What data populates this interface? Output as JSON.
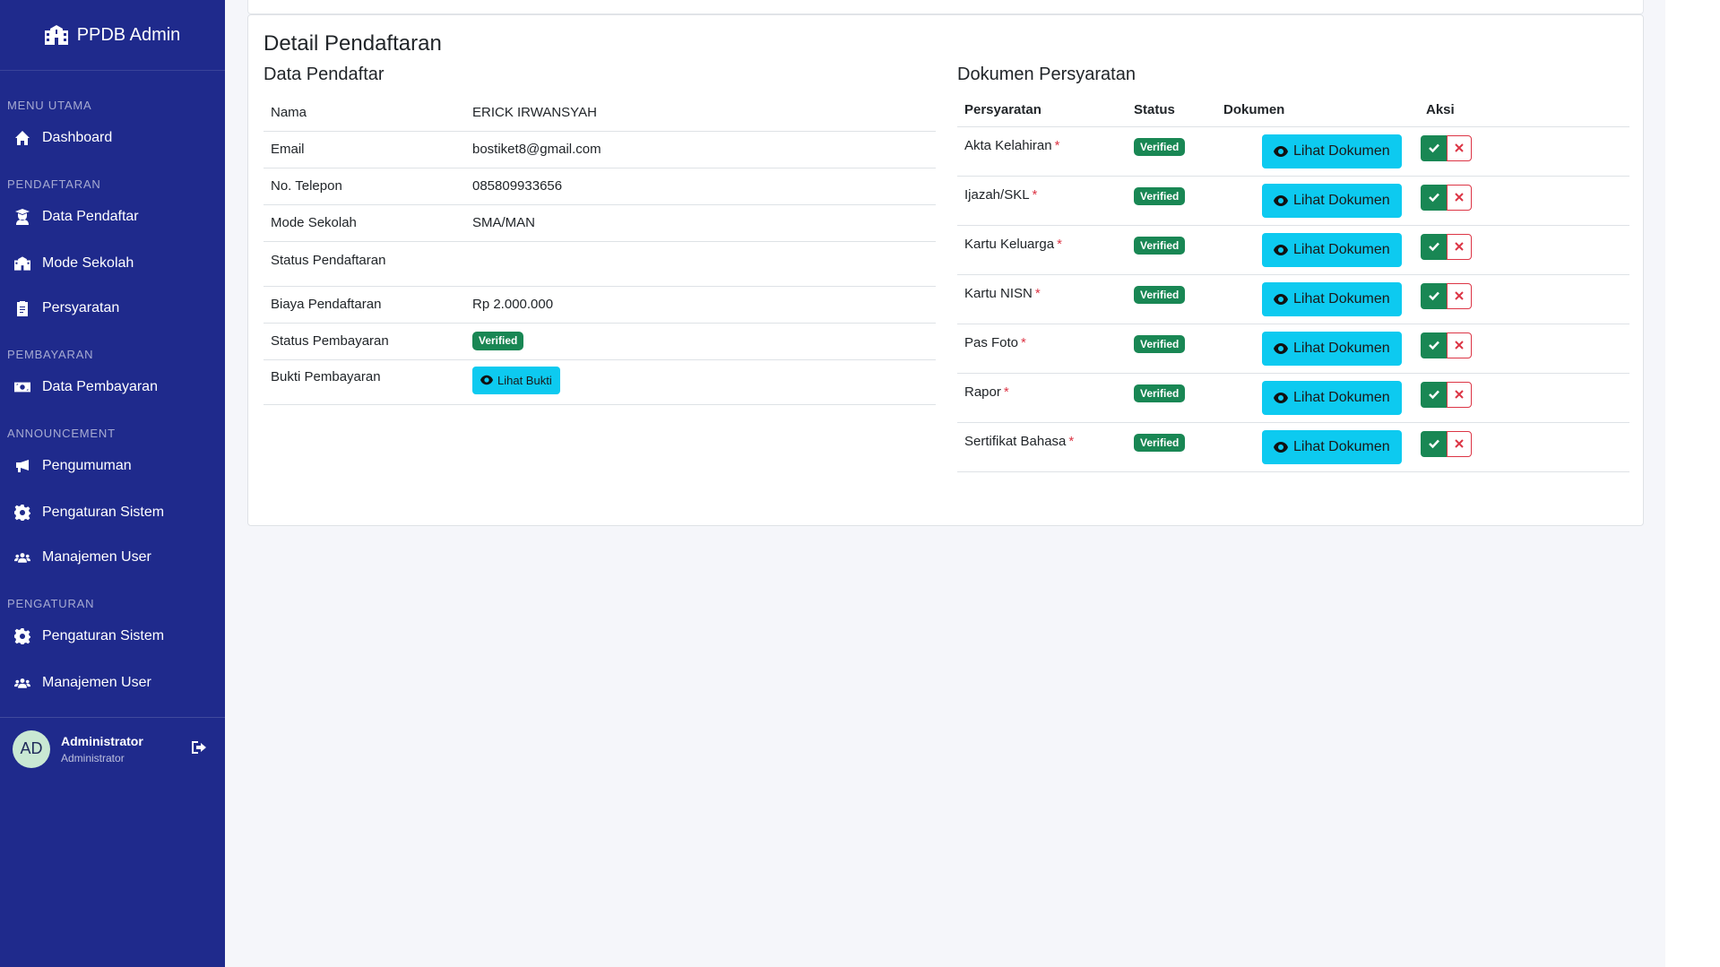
{
  "brand": {
    "name": "PPDB Admin",
    "icon": "school-icon"
  },
  "sidebar": {
    "sections": [
      {
        "title": "MENU UTAMA",
        "items": [
          {
            "label": "Dashboard",
            "icon": "home-icon"
          }
        ]
      },
      {
        "title": "PENDAFTARAN",
        "items": [
          {
            "label": "Data Pendaftar",
            "icon": "user-graduate-icon"
          },
          {
            "label": "Mode Sekolah",
            "icon": "school-icon"
          },
          {
            "label": "Persyaratan",
            "icon": "clipboard-icon"
          }
        ]
      },
      {
        "title": "PEMBAYARAN",
        "items": [
          {
            "label": "Data Pembayaran",
            "icon": "money-icon"
          }
        ]
      },
      {
        "title": "ANNOUNCEMENT",
        "items": [
          {
            "label": "Pengumuman",
            "icon": "bullhorn-icon"
          },
          {
            "label": "Pengaturan Sistem",
            "icon": "gear-icon"
          },
          {
            "label": "Manajemen User",
            "icon": "users-icon"
          }
        ]
      },
      {
        "title": "PENGATURAN",
        "items": [
          {
            "label": "Pengaturan Sistem",
            "icon": "gear-icon"
          },
          {
            "label": "Manajemen User",
            "icon": "users-icon"
          }
        ]
      }
    ],
    "user": {
      "initials": "AD",
      "name": "Administrator",
      "role": "Administrator",
      "logout_icon": "logout-icon"
    }
  },
  "main": {
    "page_title": "Detail Pendaftaran",
    "pendaftar": {
      "title": "Data Pendaftar",
      "rows": [
        {
          "label": "Nama",
          "value": "ERICK IRWANSYAH"
        },
        {
          "label": "Email",
          "value": "bostiket8@gmail.com"
        },
        {
          "label": "No. Telepon",
          "value": "085809933656"
        },
        {
          "label": "Mode Sekolah",
          "value": "SMA/MAN"
        },
        {
          "label": "Status Pendaftaran",
          "value": ""
        },
        {
          "label": "Biaya Pendaftaran",
          "value": "Rp 2.000.000"
        },
        {
          "label": "Status Pembayaran",
          "badge": "Verified"
        },
        {
          "label": "Bukti Pembayaran",
          "button": "Lihat Bukti"
        }
      ]
    },
    "dokumen": {
      "title": "Dokumen Persyaratan",
      "headers": [
        "Persyaratan",
        "Status",
        "Dokumen",
        "Aksi"
      ],
      "button_label": "Lihat Dokumen",
      "rows": [
        {
          "name": "Akta Kelahiran",
          "status": "Verified"
        },
        {
          "name": "Ijazah/SKL",
          "status": "Verified"
        },
        {
          "name": "Kartu Keluarga",
          "status": "Verified"
        },
        {
          "name": "Kartu NISN",
          "status": "Verified"
        },
        {
          "name": "Pas Foto",
          "status": "Verified"
        },
        {
          "name": "Rapor",
          "status": "Verified"
        },
        {
          "name": "Sertifikat Bahasa",
          "status": "Verified"
        }
      ],
      "required_mark": "*"
    }
  },
  "colors": {
    "sidebar": "#1f2a8c",
    "success": "#198754",
    "info": "#0dcaf0",
    "danger": "#dc3545"
  }
}
